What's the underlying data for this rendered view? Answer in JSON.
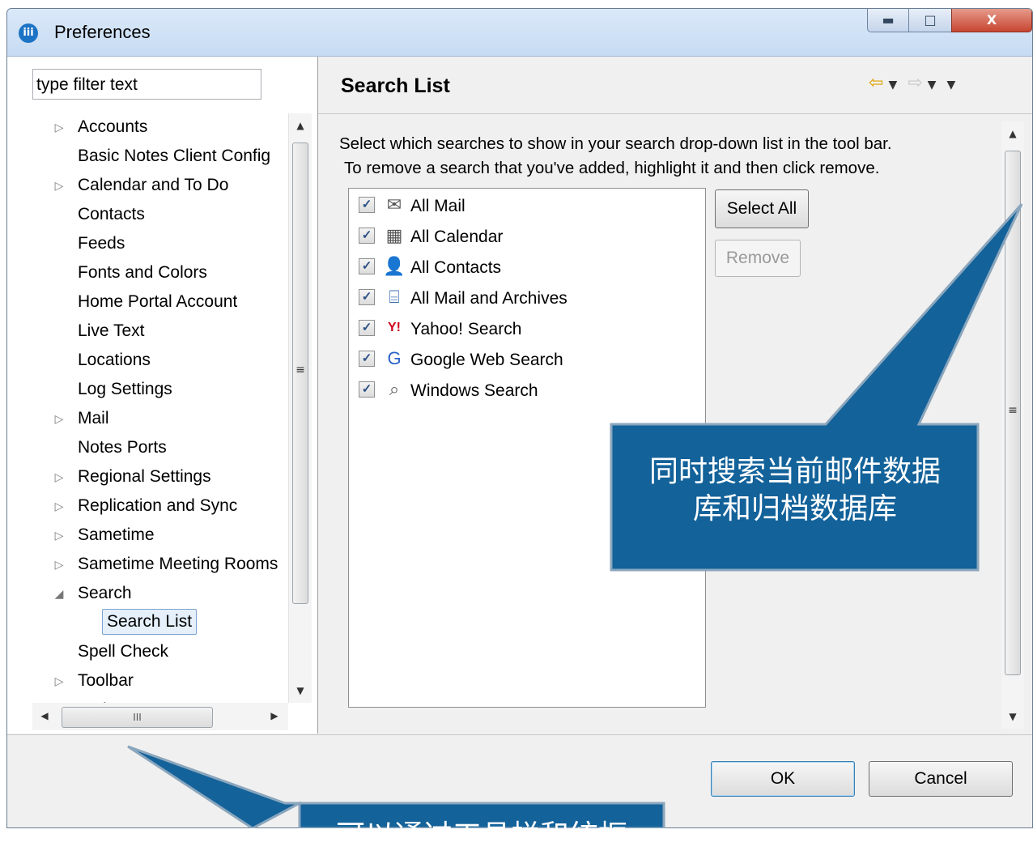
{
  "window": {
    "title": "Preferences",
    "app_icon": "notes-icon"
  },
  "filter": {
    "placeholder": "type filter text"
  },
  "tree": [
    {
      "label": "Accounts",
      "expander": "collapsed"
    },
    {
      "label": "Basic Notes Client Config",
      "expander": "none"
    },
    {
      "label": "Calendar and To Do",
      "expander": "collapsed"
    },
    {
      "label": "Contacts",
      "expander": "none"
    },
    {
      "label": "Feeds",
      "expander": "none"
    },
    {
      "label": "Fonts and Colors",
      "expander": "none"
    },
    {
      "label": "Home Portal Account",
      "expander": "none"
    },
    {
      "label": "Live Text",
      "expander": "none"
    },
    {
      "label": "Locations",
      "expander": "none"
    },
    {
      "label": "Log Settings",
      "expander": "none"
    },
    {
      "label": "Mail",
      "expander": "collapsed"
    },
    {
      "label": "Notes Ports",
      "expander": "none"
    },
    {
      "label": "Regional Settings",
      "expander": "collapsed"
    },
    {
      "label": "Replication and Sync",
      "expander": "collapsed"
    },
    {
      "label": "Sametime",
      "expander": "collapsed"
    },
    {
      "label": "Sametime Meeting Rooms",
      "expander": "collapsed"
    },
    {
      "label": "Search",
      "expander": "expanded"
    },
    {
      "label": "Search List",
      "expander": "none",
      "selected": true
    },
    {
      "label": "Spell Check",
      "expander": "none"
    },
    {
      "label": "Toolbar",
      "expander": "collapsed"
    },
    {
      "label": "Web Browser",
      "expander": "none"
    }
  ],
  "hscroll_thumb_label": "III",
  "page": {
    "title": "Search List",
    "description_line1": "Select which searches to show in your search drop-down list in the tool bar.",
    "description_line2": "To remove a search that you've added, highlight it and then click remove."
  },
  "search_list": [
    {
      "label": "All Mail",
      "checked": true,
      "icon": "mail-icon"
    },
    {
      "label": "All Calendar",
      "checked": true,
      "icon": "calendar-icon"
    },
    {
      "label": "All Contacts",
      "checked": true,
      "icon": "contacts-icon"
    },
    {
      "label": "All Mail and Archives",
      "checked": true,
      "icon": "archive-icon"
    },
    {
      "label": "Yahoo! Search",
      "checked": true,
      "icon": "yahoo-icon"
    },
    {
      "label": "Google Web Search",
      "checked": true,
      "icon": "google-icon"
    },
    {
      "label": "Windows Search",
      "checked": true,
      "icon": "windows-search-icon"
    }
  ],
  "buttons": {
    "select_all": "Select All",
    "remove": "Remove",
    "ok": "OK",
    "cancel": "Cancel"
  },
  "callouts": {
    "top_line1": "同时搜索当前邮件数据",
    "top_line2": "库和归档数据库",
    "bottom": "可以通过工具栏和统框"
  },
  "colors": {
    "callout_fill": "#13629a",
    "callout_border": "#8aa6bd"
  }
}
